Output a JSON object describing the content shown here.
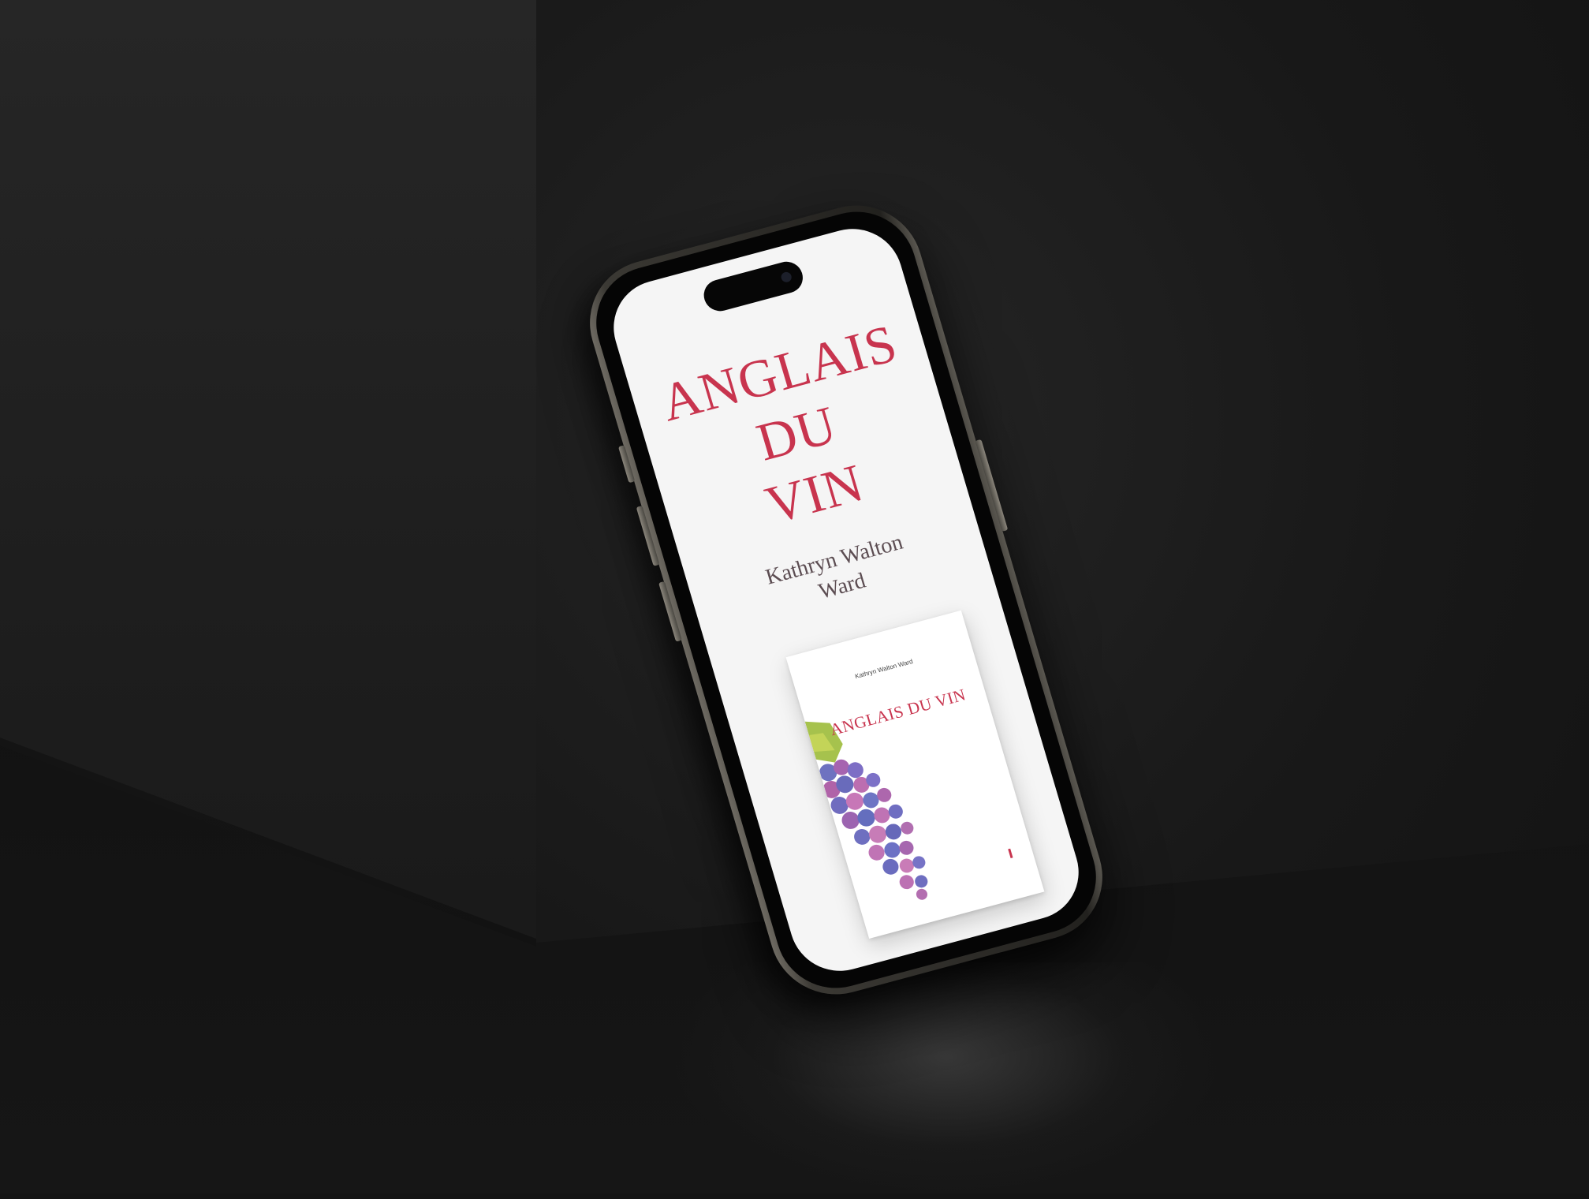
{
  "screen": {
    "title_lines": [
      "ANGLAIS",
      "DU",
      "VIN"
    ],
    "author_lines": [
      "Kathryn Walton",
      "Ward"
    ],
    "book_cover": {
      "author": "Kathryn Walton Ward",
      "title": "ANGLAIS DU VIN"
    }
  },
  "colors": {
    "title": "#c8344e",
    "author": "#5c4d52",
    "screen_bg": "#f5f5f5",
    "backdrop": "#141414"
  },
  "icons": {
    "camera": "camera-icon",
    "cover_art": "grapes-icon"
  }
}
